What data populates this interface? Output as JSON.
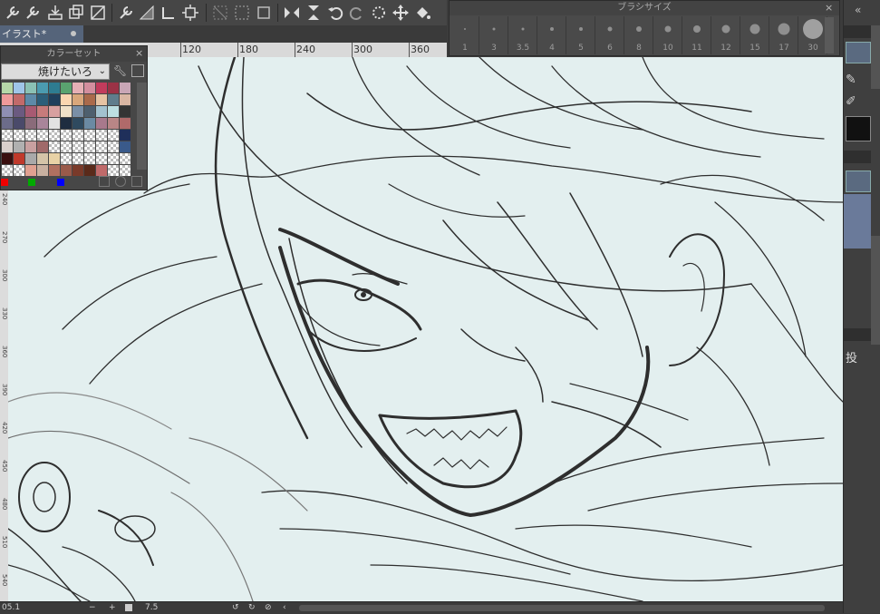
{
  "document": {
    "tab_title": "イラスト*"
  },
  "ruler": {
    "labels": [
      "120",
      "180",
      "240",
      "300",
      "360"
    ]
  },
  "vruler": {
    "labels": [
      "240",
      "270",
      "300",
      "330",
      "360",
      "390",
      "420",
      "450",
      "480",
      "510",
      "540"
    ]
  },
  "brush_panel": {
    "title": "ブラシサイズ",
    "sizes": [
      "1",
      "3",
      "3.5",
      "4",
      "5",
      "6",
      "8",
      "10",
      "11",
      "12",
      "15",
      "17",
      "30"
    ]
  },
  "color_panel": {
    "title": "カラーセット",
    "selected_set": "焼けたいろ",
    "swatch_colors": [
      [
        "#b6d7a8",
        "#9fc5e8",
        "#8bc1b4",
        "#4b9bb0",
        "#2e7c91",
        "#5aa36f",
        "#e6b0b5",
        "#d38e9e",
        "#c23b5c",
        "#9b3246",
        "#c9a6b6"
      ],
      [
        "#ef9a9a",
        "#c26a6a",
        "#5d8aa8",
        "#2c5e79",
        "#1f3f5c",
        "#fbd6b0",
        "#d9a77b",
        "#aa6a4b",
        "#e6c3a3",
        "#5f7d8c",
        "#d9b6a3"
      ],
      [
        "#8f8fb3",
        "#6b5a80",
        "#a85a72",
        "#c77b7b",
        "#d7a0a0",
        "#efe0c8",
        "#7a8fa6",
        "#4e5f6e",
        "#a3c2cf",
        "#bcdfe1",
        "#343434"
      ],
      [
        "#6c6c8a",
        "#4a4a6a",
        "#8a6b7a",
        "#a9859a",
        "#e2e2e2",
        "#1f2d40",
        "#2f4a5f",
        "#6b8aa3",
        "#a8798c",
        "#b98686",
        "#b06a6a"
      ],
      [
        "#checker",
        "#checker",
        "#checker",
        "#checker",
        "#checker",
        "#checker",
        "#checker",
        "#checker",
        "#checker",
        "#checker",
        "#1f2f5a"
      ],
      [
        "#d9d0cc",
        "#b0b0b0",
        "#c8a0a0",
        "#a06a6a",
        "#checker",
        "#checker",
        "#checker",
        "#checker",
        "#checker",
        "#checker",
        "#3a5a8a"
      ],
      [
        "#3a0f0f",
        "#c0392b",
        "#a9a9a9",
        "#d4c4a8",
        "#e8d2a6",
        "#checker",
        "#checker",
        "#checker",
        "#checker",
        "#checker",
        "#checker"
      ],
      [
        "#checker",
        "#checker",
        "#e0a090",
        "#c8b0a0",
        "#b07060",
        "#9a5a4a",
        "#7a3a2a",
        "#5a2a1a",
        "#c06a6a",
        "#checker",
        "#checker"
      ]
    ],
    "bottom_dots": [
      "#ff0000",
      "#00a000",
      "#0000ff"
    ]
  },
  "right_dock": {
    "visible_char": "投"
  },
  "status_bar": {
    "zoom_left": "05.1",
    "zoom_value": "7.5"
  }
}
